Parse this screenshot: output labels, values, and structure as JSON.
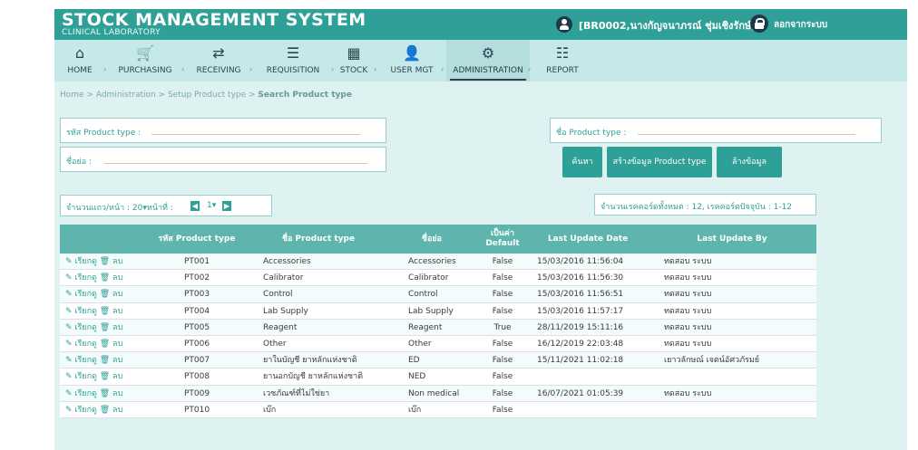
{
  "header": {
    "title": "STOCK MANAGEMENT SYSTEM",
    "subtitle": "CLINICAL LABORATORY",
    "user": "[BR0002,นางกัญจนาภรณ์ ชุ่มเชิงรักษ์]",
    "logout": "ลอกจากระบบ"
  },
  "nav": [
    {
      "label": "HOME",
      "icon": "home-icon",
      "glyph": "⌂"
    },
    {
      "label": "PURCHASING",
      "icon": "cart-icon",
      "glyph": "🛒"
    },
    {
      "label": "RECEIVING",
      "icon": "receive-icon",
      "glyph": "⇄"
    },
    {
      "label": "REQUISITION",
      "icon": "checklist-icon",
      "glyph": "☰"
    },
    {
      "label": "STOCK",
      "icon": "grid-icon",
      "glyph": "▦"
    },
    {
      "label": "USER MGT",
      "icon": "user-icon",
      "glyph": "👤"
    },
    {
      "label": "ADMINISTRATION",
      "icon": "gear-icon",
      "glyph": "⚙"
    },
    {
      "label": "REPORT",
      "icon": "report-icon",
      "glyph": "☷"
    }
  ],
  "breadcrumb": {
    "path": "Home > Administration > Setup Product type > ",
    "current": "Search Product type"
  },
  "search": {
    "code_label": "รหัส Product type :",
    "name_label": "ชื่อ Product type :",
    "short_label": "ชื่อย่อ :",
    "btn_search": "ค้นหา",
    "btn_create": "สร้างข้อมูล Product type",
    "btn_clear": "ล้างข้อมูล"
  },
  "pager": {
    "text": "จำนวนแถว/หน้า : 20▾หน้าที่ :",
    "page": "1▾"
  },
  "count_text": "จำนวนเรคคอร์ดทั้งหมด : 12, เรคคอร์ดปัจจุบัน : 1-12",
  "table": {
    "headers": [
      "",
      "รหัส Product type",
      "ชื่อ Product type",
      "ชื่อย่อ",
      "เป็นค่า Default",
      "Last Update Date",
      "Last Update By"
    ],
    "edit_label": "✎ เรียกดู",
    "delete_label": "🗑 ลบ",
    "rows": [
      {
        "code": "PT001",
        "name": "Accessories",
        "short": "Accessories",
        "def": "False",
        "date": "15/03/2016 11:56:04",
        "by": "ทดสอบ ระบบ"
      },
      {
        "code": "PT002",
        "name": "Calibrator",
        "short": "Calibrator",
        "def": "False",
        "date": "15/03/2016 11:56:30",
        "by": "ทดสอบ ระบบ"
      },
      {
        "code": "PT003",
        "name": "Control",
        "short": "Control",
        "def": "False",
        "date": "15/03/2016 11:56:51",
        "by": "ทดสอบ ระบบ"
      },
      {
        "code": "PT004",
        "name": "Lab Supply",
        "short": "Lab Supply",
        "def": "False",
        "date": "15/03/2016 11:57:17",
        "by": "ทดสอบ ระบบ"
      },
      {
        "code": "PT005",
        "name": "Reagent",
        "short": "Reagent",
        "def": "True",
        "date": "28/11/2019 15:11:16",
        "by": "ทดสอบ ระบบ"
      },
      {
        "code": "PT006",
        "name": "Other",
        "short": "Other",
        "def": "False",
        "date": "16/12/2019 22:03:48",
        "by": "ทดสอบ ระบบ"
      },
      {
        "code": "PT007",
        "name": "ยาในบัญชี ยาหลักแห่งชาติ",
        "short": "ED",
        "def": "False",
        "date": "15/11/2021 11:02:18",
        "by": "เยาวลักษณ์ เจตน์อัศวภัรมย์"
      },
      {
        "code": "PT008",
        "name": "ยานอกบัญชี ยาหลักแห่งชาติ",
        "short": "NED",
        "def": "False",
        "date": "",
        "by": ""
      },
      {
        "code": "PT009",
        "name": "เวชภัณฑ์ที่ไม่ใช่ยา",
        "short": "Non medical",
        "def": "False",
        "date": "16/07/2021 01:05:39",
        "by": "ทดสอบ ระบบ"
      },
      {
        "code": "PT010",
        "name": "เบ๊ก",
        "short": "เบ๊ก",
        "def": "False",
        "date": "",
        "by": ""
      }
    ]
  }
}
